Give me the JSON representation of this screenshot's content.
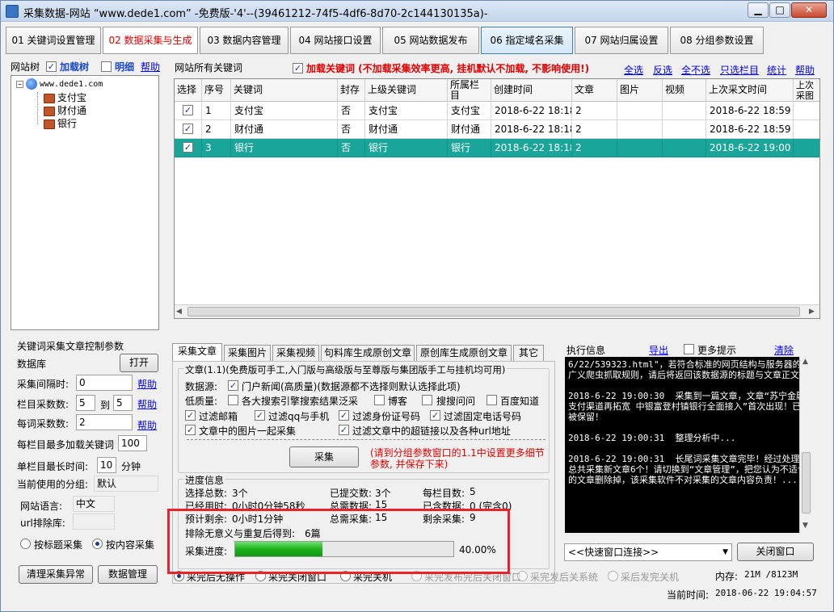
{
  "window": {
    "title": "采集数据-网站 “www.dede1.com”  -免费版-'4'--(39461212-74f5-4df6-8d70-2c144130135a)-",
    "min": "▁",
    "max": "□",
    "close": "✕"
  },
  "main_tabs": [
    {
      "label": "01 关键词设置管理"
    },
    {
      "label": "02 数据采集与生成"
    },
    {
      "label": "03 数据内容管理"
    },
    {
      "label": "04 网站接口设置"
    },
    {
      "label": "05 网站数据发布"
    },
    {
      "label": "06 指定域名采集"
    },
    {
      "label": "07 网站归属设置"
    },
    {
      "label": "08 分组参数设置"
    }
  ],
  "site_tree": {
    "title": "网站树",
    "load_tree": "加载树",
    "detail": "明细",
    "help": "帮助",
    "root": "www.dede1.com",
    "children": [
      "支付宝",
      "财付通",
      "银行"
    ]
  },
  "keywords_panel": {
    "title": "网站所有关键词",
    "load_notice": "加载关键词 (不加载采集效率更高, 挂机默认不加载, 不影响使用!)",
    "links": [
      "全选",
      "反选",
      "全不选",
      "只选栏目",
      "统计",
      "帮助"
    ]
  },
  "grid": {
    "headers": [
      "选择",
      "序号",
      "关键词",
      "封存",
      "上级关键词",
      "所属栏目",
      "创建时间",
      "文章",
      "图片",
      "视频",
      "上次采文时间",
      "上次采图时间"
    ],
    "rows": [
      {
        "checked": "✓",
        "no": "1",
        "keyword": "支付宝",
        "sealed": "否",
        "parent": "支付宝",
        "column": "支付宝",
        "created": "2018-6-22 18:18",
        "articles": "2",
        "images": "",
        "videos": "",
        "last": "2018-6-22 18:59"
      },
      {
        "checked": "✓",
        "no": "2",
        "keyword": "财付通",
        "sealed": "否",
        "parent": "财付通",
        "column": "财付通",
        "created": "2018-6-22 18:18",
        "articles": "2",
        "images": "",
        "videos": "",
        "last": "2018-6-22 18:59"
      },
      {
        "checked": "✓",
        "no": "3",
        "keyword": "银行",
        "sealed": "否",
        "parent": "银行",
        "column": "银行",
        "created": "2018-6-22 18:18",
        "articles": "2",
        "images": "",
        "videos": "",
        "last": "2018-6-22 19:00"
      }
    ]
  },
  "control": {
    "title": "关键词采集文章控制参数",
    "database_label": "数据库",
    "open_btn": "打开",
    "interval_label": "采集间隔时:",
    "interval_value": "0",
    "column_count_label": "栏目采数数:",
    "column_from": "5",
    "to": "到",
    "column_to": "5",
    "per_word_label": "每词采数数:",
    "per_word_value": "2",
    "max_words_label": "每栏目最多加载关键词",
    "max_words_value": "100",
    "max_time_label": "单栏目最长时间:",
    "max_time_value": "10",
    "minutes": "分钟",
    "group_label": "当前使用的分组:",
    "group_value": "默认",
    "lang_label": "网站语言:",
    "lang_value": "中文",
    "url_exclude_label": "url排除库:",
    "help": "帮助",
    "radio_title": "按标题采集",
    "radio_content": "按内容采集",
    "btn_clean": "清理采集异常",
    "btn_data": "数据管理"
  },
  "sub_tabs": [
    "采集文章",
    "采集图片",
    "采集视频",
    "句料库生成原创文章",
    "原创库生成原创文章",
    "其它"
  ],
  "article": {
    "legend": "文章(1.1)(免费版可手工,入门版与高级版与至尊版与集团版手工与挂机均可用)",
    "source_label": "数据源:",
    "source_opt": "门户新闻(高质量)(数据源都不选择则默认选择此项)",
    "low_label": "低质量:",
    "low_opts": [
      "各大搜索引擎搜索结果泛采",
      "博客",
      "搜搜问问",
      "百度知道"
    ],
    "filters": [
      "过滤邮箱",
      "过滤qq与手机",
      "过滤身份证号码",
      "过滤固定电话号码"
    ],
    "img_opt": "文章中的图片一起采集",
    "link_opt": "过滤文章中的超链接以及各种url地址",
    "collect_btn": "采集",
    "collect_note": "(请到分组参数窗口的1.1中设置更多细节参数, 并保存下来)"
  },
  "progress": {
    "legend": "进度信息",
    "total_label": "选择总数:",
    "total": "3个",
    "submitted_label": "已提交数:",
    "submitted": "3个",
    "per_col_label": "每栏目数:",
    "per_col": "5",
    "elapsed_label": "已经用时:",
    "elapsed": "0小时0分钟58秒",
    "need_label": "总需数据:",
    "need": "15",
    "have_label": "已含数据:",
    "have": "0 (完含0)",
    "remain_time_label": "预计剩余:",
    "remain_time": "0小时1分钟",
    "total_collect_label": "总需采集:",
    "total_collect": "15",
    "remain_collect_label": "剩余采集:",
    "remain_collect": "9",
    "dedupe_label": "排除无意义与重复后得到:",
    "dedupe": "6篇",
    "bar_label": "采集进度:",
    "percent_text": "40.00%",
    "percent": 40
  },
  "after": {
    "opts": [
      "采完后无操作",
      "采完关闭窗口",
      "采完关机",
      "采完发布完后关闭窗口",
      "采完发后关系统",
      "采后发完关机"
    ]
  },
  "exec": {
    "title": "执行信息",
    "export": "导出",
    "more": "更多提示",
    "clear": "清除",
    "log": [
      "6/22/539323.html\"，若符合标准的网页结构与服务器的广义爬虫抓取规则，请后将返回该数据源的标题与文章正文！",
      "2018-6-22 19:00:30  采集到一篇文章，文章“苏宁金融支付渠道再拓宽 中银富登村镇银行全面接入”首次出现！已被保留！",
      "2018-6-22 19:00:31  整理分析中...",
      "2018-6-22 19:00:31  长尾词采集文章完毕！经过处理后总共采集新文章6个！请切换到“文章管理”，把您认为不适合的文章删除掉，该采集软件不对采集的文章内容负责！..."
    ],
    "quick_conn": "<<快速窗口连接>>",
    "close_btn": "关闭窗口",
    "mem_label": "内存:",
    "mem": "21M /8123M",
    "time_label": "当前时间:",
    "time": "2018-06-22 19:04:57"
  }
}
